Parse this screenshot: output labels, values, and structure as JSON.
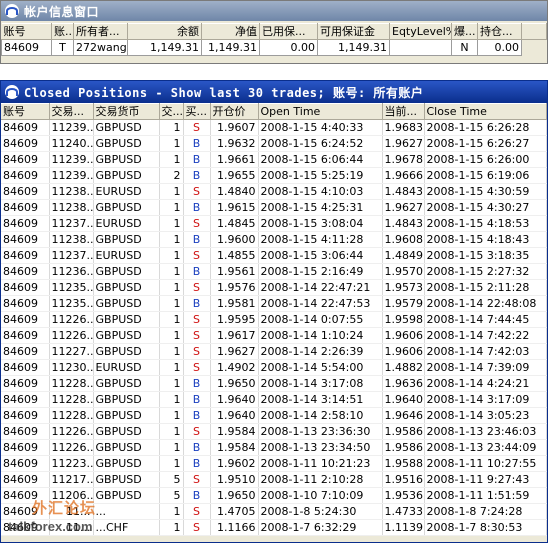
{
  "account_window": {
    "title": "帐户信息窗口",
    "columns": [
      "账号",
      "账...",
      "所有者...",
      "余额",
      "净值",
      "已用保...",
      "可用保证金",
      "EqtyLevel%",
      "爆...",
      "持仓..."
    ],
    "row": [
      "84609",
      "T",
      "272wang...",
      "1,149.31",
      "1,149.31",
      "0.00",
      "1,149.31",
      "",
      "N",
      "0.00"
    ]
  },
  "closed_window": {
    "title": "Closed Positions - Show last 30 trades; 账号: 所有账户",
    "columns": [
      "账号",
      "交易...",
      "交易货币",
      "交...",
      "买...",
      "开仓价",
      "Open Time",
      "当前...",
      "Close Time"
    ],
    "rows": [
      [
        "84609",
        "11239...",
        "GBPUSD",
        "1",
        "S",
        "1.9607",
        "2008-1-15 4:40:33",
        "1.9683",
        "2008-1-15 6:26:28"
      ],
      [
        "84609",
        "11240...",
        "GBPUSD",
        "1",
        "B",
        "1.9632",
        "2008-1-15 6:24:52",
        "1.9627",
        "2008-1-15 6:26:27"
      ],
      [
        "84609",
        "11239...",
        "GBPUSD",
        "1",
        "B",
        "1.9661",
        "2008-1-15 6:06:44",
        "1.9678",
        "2008-1-15 6:26:00"
      ],
      [
        "84609",
        "11239...",
        "GBPUSD",
        "2",
        "B",
        "1.9655",
        "2008-1-15 5:25:19",
        "1.9666",
        "2008-1-15 6:19:06"
      ],
      [
        "84609",
        "11238...",
        "EURUSD",
        "1",
        "S",
        "1.4840",
        "2008-1-15 4:10:03",
        "1.4843",
        "2008-1-15 4:30:59"
      ],
      [
        "84609",
        "11238...",
        "GBPUSD",
        "1",
        "B",
        "1.9615",
        "2008-1-15 4:25:31",
        "1.9627",
        "2008-1-15 4:30:27"
      ],
      [
        "84609",
        "11237...",
        "EURUSD",
        "1",
        "S",
        "1.4845",
        "2008-1-15 3:08:04",
        "1.4843",
        "2008-1-15 4:18:53"
      ],
      [
        "84609",
        "11238...",
        "GBPUSD",
        "1",
        "B",
        "1.9600",
        "2008-1-15 4:11:28",
        "1.9608",
        "2008-1-15 4:18:43"
      ],
      [
        "84609",
        "11237...",
        "EURUSD",
        "1",
        "S",
        "1.4855",
        "2008-1-15 3:06:44",
        "1.4849",
        "2008-1-15 3:18:35"
      ],
      [
        "84609",
        "11236...",
        "GBPUSD",
        "1",
        "B",
        "1.9561",
        "2008-1-15 2:16:49",
        "1.9570",
        "2008-1-15 2:27:32"
      ],
      [
        "84609",
        "11235...",
        "GBPUSD",
        "1",
        "S",
        "1.9576",
        "2008-1-14 22:47:21",
        "1.9573",
        "2008-1-15 2:11:28"
      ],
      [
        "84609",
        "11235...",
        "GBPUSD",
        "1",
        "B",
        "1.9581",
        "2008-1-14 22:47:53",
        "1.9579",
        "2008-1-14 22:48:08"
      ],
      [
        "84609",
        "11226...",
        "GBPUSD",
        "1",
        "S",
        "1.9595",
        "2008-1-14 0:07:55",
        "1.9598",
        "2008-1-14 7:44:45"
      ],
      [
        "84609",
        "11226...",
        "GBPUSD",
        "1",
        "S",
        "1.9617",
        "2008-1-14 1:10:24",
        "1.9606",
        "2008-1-14 7:42:22"
      ],
      [
        "84609",
        "11227...",
        "GBPUSD",
        "1",
        "S",
        "1.9627",
        "2008-1-14 2:26:39",
        "1.9606",
        "2008-1-14 7:42:03"
      ],
      [
        "84609",
        "11230...",
        "EURUSD",
        "1",
        "S",
        "1.4902",
        "2008-1-14 5:54:00",
        "1.4882",
        "2008-1-14 7:39:09"
      ],
      [
        "84609",
        "11228...",
        "GBPUSD",
        "1",
        "B",
        "1.9650",
        "2008-1-14 3:17:08",
        "1.9636",
        "2008-1-14 4:24:21"
      ],
      [
        "84609",
        "11228...",
        "GBPUSD",
        "1",
        "B",
        "1.9640",
        "2008-1-14 3:14:51",
        "1.9640",
        "2008-1-14 3:17:09"
      ],
      [
        "84609",
        "11228...",
        "GBPUSD",
        "1",
        "B",
        "1.9640",
        "2008-1-14 2:58:10",
        "1.9646",
        "2008-1-14 3:05:23"
      ],
      [
        "84609",
        "11226...",
        "GBPUSD",
        "1",
        "S",
        "1.9584",
        "2008-1-13 23:36:30",
        "1.9586",
        "2008-1-13 23:46:03"
      ],
      [
        "84609",
        "11226...",
        "GBPUSD",
        "1",
        "B",
        "1.9584",
        "2008-1-13 23:34:50",
        "1.9586",
        "2008-1-13 23:44:09"
      ],
      [
        "84609",
        "11223...",
        "GBPUSD",
        "1",
        "B",
        "1.9602",
        "2008-1-11 10:21:23",
        "1.9588",
        "2008-1-11 10:27:55"
      ],
      [
        "84609",
        "11217...",
        "GBPUSD",
        "5",
        "S",
        "1.9510",
        "2008-1-11 2:10:28",
        "1.9516",
        "2008-1-11 9:27:43"
      ],
      [
        "84609",
        "11206...",
        "GBPUSD",
        "5",
        "B",
        "1.9650",
        "2008-1-10 7:10:09",
        "1.9536",
        "2008-1-11 1:51:59"
      ],
      [
        "84609",
        "11...",
        "...",
        "1",
        "S",
        "1.4705",
        "2008-1-8 5:24:30",
        "1.4733",
        "2008-1-8 7:24:28"
      ],
      [
        "84609",
        "11...",
        "...CHF",
        "1",
        "S",
        "1.1166",
        "2008-1-7 6:32:29",
        "1.1139",
        "2008-1-7 8:30:53"
      ]
    ]
  },
  "watermark": {
    "cn": "外汇论坛",
    "en": "talkforex.com"
  }
}
